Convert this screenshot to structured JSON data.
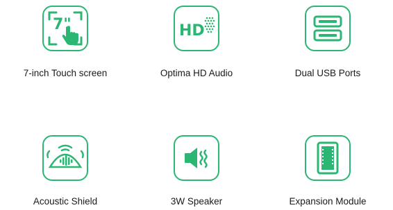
{
  "features": [
    {
      "label": "7-inch Touch screen",
      "icon": "touch-screen-icon",
      "icon_text": "7\""
    },
    {
      "label": "Optima HD Audio",
      "icon": "hd-audio-icon",
      "icon_text": "HD"
    },
    {
      "label": "Dual USB Ports",
      "icon": "usb-ports-icon"
    },
    {
      "label": "Acoustic Shield",
      "icon": "acoustic-shield-icon"
    },
    {
      "label": "3W Speaker",
      "icon": "speaker-icon"
    },
    {
      "label": "Expansion Module",
      "icon": "expansion-module-icon"
    }
  ],
  "colors": {
    "accent": "#2bb673",
    "text": "#1a1a1a"
  }
}
